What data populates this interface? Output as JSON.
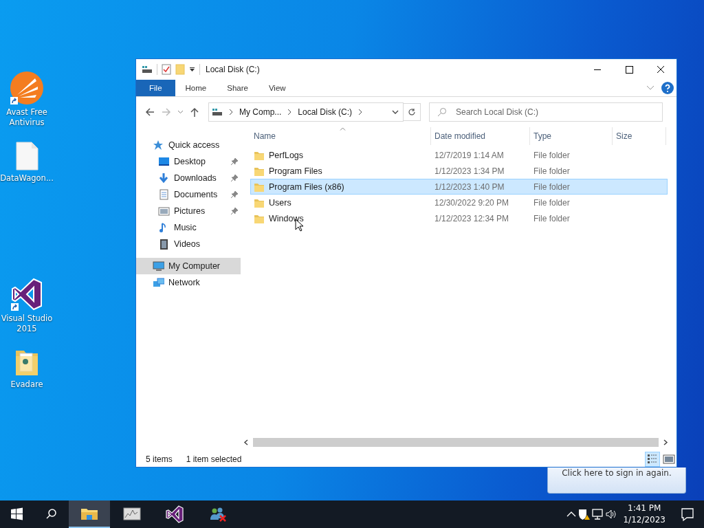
{
  "desktop_icons": [
    {
      "label": "Avast Free Antivirus",
      "kind": "avast",
      "shortcut": true
    },
    {
      "label": "DataWagon...",
      "kind": "file",
      "shortcut": false
    },
    {
      "label": "Visual Studio 2015",
      "kind": "vs",
      "shortcut": true
    },
    {
      "label": "Evadare",
      "kind": "folder",
      "shortcut": false
    }
  ],
  "notification": {
    "text": "Click here to sign in again."
  },
  "window": {
    "title": "Local Disk (C:)",
    "ribbon_tabs": [
      {
        "label": "File",
        "kind": "file"
      },
      {
        "label": "Home",
        "kind": "tab"
      },
      {
        "label": "Share",
        "kind": "tab"
      },
      {
        "label": "View",
        "kind": "tab"
      }
    ],
    "address": [
      "My Comp...",
      "Local Disk (C:)"
    ],
    "search": {
      "placeholder": "Search Local Disk (C:)"
    },
    "nav": [
      {
        "label": "Quick access",
        "kind": "star",
        "selected": false,
        "children": [
          {
            "label": "Desktop",
            "kind": "desktop",
            "pinned": true,
            "selected": false
          },
          {
            "label": "Downloads",
            "kind": "download",
            "pinned": true,
            "selected": false
          },
          {
            "label": "Documents",
            "kind": "document",
            "pinned": true,
            "selected": false
          },
          {
            "label": "Pictures",
            "kind": "picture",
            "pinned": true,
            "selected": false
          },
          {
            "label": "Music",
            "kind": "music",
            "pinned": false,
            "selected": false
          },
          {
            "label": "Videos",
            "kind": "video",
            "pinned": false,
            "selected": false
          }
        ]
      },
      {
        "label": "My Computer",
        "kind": "computer",
        "selected": true
      },
      {
        "label": "Network",
        "kind": "network",
        "selected": false
      }
    ],
    "columns": [
      {
        "label": "Name",
        "sorted": true
      },
      {
        "label": "Date modified",
        "sorted": false
      },
      {
        "label": "Type",
        "sorted": false
      },
      {
        "label": "Size",
        "sorted": false
      }
    ],
    "rows": [
      {
        "name": "PerfLogs",
        "date": "12/7/2019 1:14 AM",
        "type": "File folder",
        "selected": false
      },
      {
        "name": "Program Files",
        "date": "1/12/2023 1:34 PM",
        "type": "File folder",
        "selected": false
      },
      {
        "name": "Program Files (x86)",
        "date": "1/12/2023 1:40 PM",
        "type": "File folder",
        "selected": true
      },
      {
        "name": "Users",
        "date": "12/30/2022 9:20 PM",
        "type": "File folder",
        "selected": false
      },
      {
        "name": "Windows",
        "date": "1/12/2023 12:34 PM",
        "type": "File folder",
        "selected": false
      }
    ],
    "status": [
      "5 items",
      "1 item selected"
    ],
    "views": [
      {
        "kind": "details",
        "selected": true
      },
      {
        "kind": "large",
        "selected": false
      }
    ]
  },
  "taskbar": {
    "apps": [
      {
        "kind": "explorer",
        "active": true
      },
      {
        "kind": "monitor",
        "active": false
      },
      {
        "kind": "vs",
        "active": false
      },
      {
        "kind": "users",
        "active": false
      }
    ],
    "time": "1:41 PM",
    "date": "1/12/2023"
  }
}
